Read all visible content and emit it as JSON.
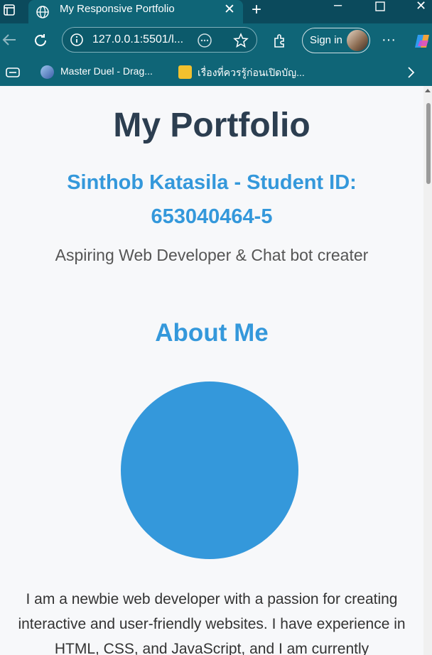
{
  "browser": {
    "tab_title": "My Responsive Portfolio",
    "url": "127.0.0.1:5501/l...",
    "signin_label": "Sign in",
    "bookmarks": [
      "Master Duel - Drag...",
      "เรื่องที่ควรรู้ก่อนเปิดบัญ..."
    ]
  },
  "page": {
    "title": "My Portfolio",
    "name_line": "Sinthob Katasila - Student ID: 653040464-5",
    "tagline": "Aspiring Web Developer & Chat bot creater",
    "about_heading": "About Me",
    "bio": "I am a newbie web developer with a passion for creating interactive and user-friendly websites. I have experience in HTML, CSS, and JavaScript, and I am currently"
  },
  "colors": {
    "chrome": "#0f6577",
    "titlebar": "#0b4a5c",
    "heading": "#2c3e50",
    "accent": "#3498db"
  }
}
